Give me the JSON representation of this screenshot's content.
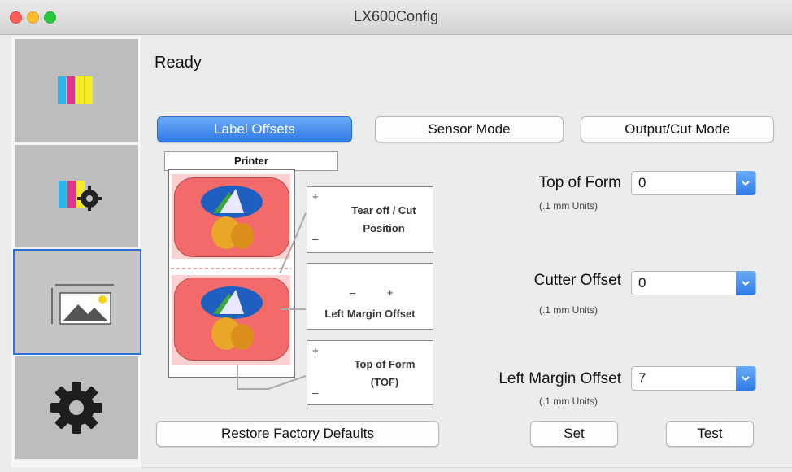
{
  "window": {
    "title": "LX600Config"
  },
  "sidebar": {
    "items": [
      {
        "name": "ink-levels",
        "icon": "ink-cartridges-icon"
      },
      {
        "name": "ink-settings",
        "icon": "ink-gear-icon"
      },
      {
        "name": "label-setup",
        "icon": "label-image-icon",
        "selected": true
      },
      {
        "name": "settings",
        "icon": "gear-icon"
      }
    ]
  },
  "status": "Ready",
  "tabs": [
    {
      "label": "Label Offsets",
      "active": true
    },
    {
      "label": "Sensor Mode",
      "active": false
    },
    {
      "label": "Output/Cut Mode",
      "active": false
    }
  ],
  "diagram": {
    "printer_label": "Printer",
    "tear_off_label": "Tear off / Cut Position",
    "left_margin_label": "Left Margin Offset",
    "top_of_form_label": "Top of Form (TOF)",
    "minus": "–",
    "plus": "+"
  },
  "fields": [
    {
      "label": "Top of Form",
      "units": "(.1 mm Units)",
      "value": "0"
    },
    {
      "label": "Cutter Offset",
      "units": "(.1 mm Units)",
      "value": "0"
    },
    {
      "label": "Left Margin Offset",
      "units": "(.1 mm Units)",
      "value": "7"
    }
  ],
  "buttons": {
    "restore": "Restore Factory Defaults",
    "set": "Set",
    "test": "Test"
  },
  "colors": {
    "accent": "#2f7ae8",
    "label_red": "#f26a6a",
    "sidebar_bg": "#bdbdbd"
  }
}
